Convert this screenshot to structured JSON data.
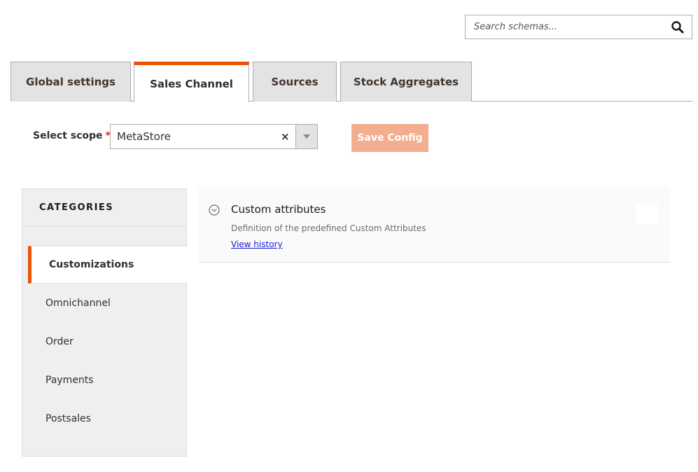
{
  "search": {
    "placeholder": "Search schemas...",
    "value": "",
    "icon": "search-icon"
  },
  "tabs": [
    {
      "label": "Global settings",
      "active": false
    },
    {
      "label": "Sales Channel",
      "active": true
    },
    {
      "label": "Sources",
      "active": false
    },
    {
      "label": "Stock Aggregates",
      "active": false
    }
  ],
  "scope": {
    "label": "Select scope",
    "required_mark": "*",
    "value": "MetaStore",
    "clear_icon": "×"
  },
  "toolbar": {
    "save_label": "Save Config"
  },
  "sidebar": {
    "heading": "CATEGORIES",
    "items": [
      {
        "label": "Customizations",
        "active": true
      },
      {
        "label": "Omnichannel",
        "active": false
      },
      {
        "label": "Order",
        "active": false
      },
      {
        "label": "Payments",
        "active": false
      },
      {
        "label": "Postsales",
        "active": false
      }
    ]
  },
  "panel": {
    "title": "Custom attributes",
    "description": "Definition of the predefined Custom Attributes",
    "link": "View history"
  },
  "colors": {
    "accent": "#eb5202",
    "save_disabled": "#f3ad8f",
    "required": "#e22626",
    "link": "#1a1adb"
  }
}
